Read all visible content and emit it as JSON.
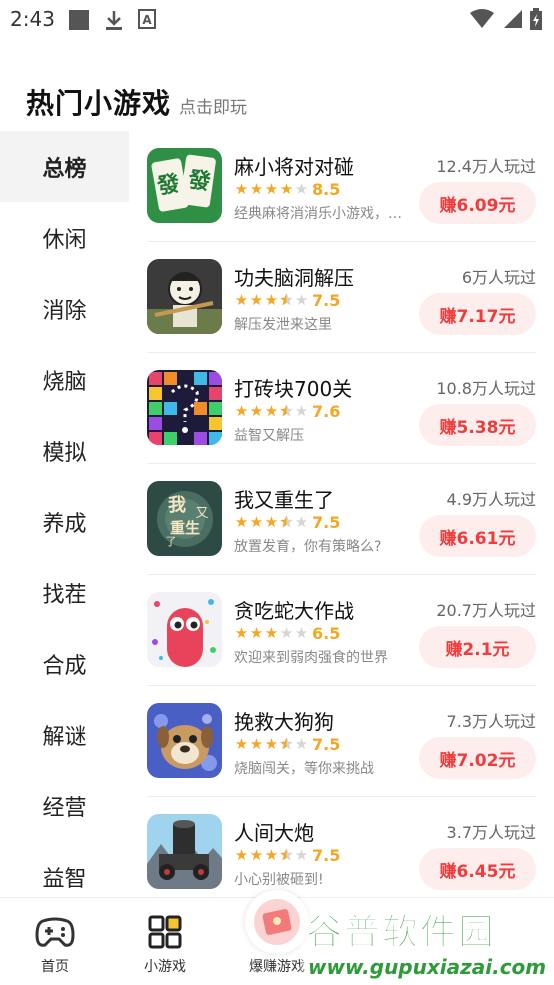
{
  "status_bar": {
    "time": "2:43"
  },
  "header": {
    "title": "热门小游戏",
    "subtitle": "点击即玩"
  },
  "sidebar": {
    "items": [
      {
        "label": "总榜",
        "active": true
      },
      {
        "label": "休闲"
      },
      {
        "label": "消除"
      },
      {
        "label": "烧脑"
      },
      {
        "label": "模拟"
      },
      {
        "label": "养成"
      },
      {
        "label": "找茬"
      },
      {
        "label": "合成"
      },
      {
        "label": "解谜"
      },
      {
        "label": "经营"
      },
      {
        "label": "益智"
      }
    ]
  },
  "games": [
    {
      "name": "麻小将对对碰",
      "players": "12.4万人玩过",
      "rating": "8.5",
      "stars": 4.0,
      "desc": "经典麻将消消乐小游戏，…",
      "earn": "赚6.09元",
      "icon": "mahjong-game-icon"
    },
    {
      "name": "功夫脑洞解压",
      "players": "6万人玩过",
      "rating": "7.5",
      "stars": 3.5,
      "desc": "解压发泄来这里",
      "earn": "赚7.17元",
      "icon": "kungfu-game-icon"
    },
    {
      "name": "打砖块700关",
      "players": "10.8万人玩过",
      "rating": "7.6",
      "stars": 3.5,
      "desc": "益智又解压",
      "earn": "赚5.38元",
      "icon": "brick-breaker-game-icon"
    },
    {
      "name": "我又重生了",
      "players": "4.9万人玩过",
      "rating": "7.5",
      "stars": 3.5,
      "desc": "放置发育，你有策略么?",
      "earn": "赚6.61元",
      "icon": "reborn-game-icon"
    },
    {
      "name": "贪吃蛇大作战",
      "players": "20.7万人玩过",
      "rating": "6.5",
      "stars": 3.0,
      "desc": "欢迎来到弱肉强食的世界",
      "earn": "赚2.1元",
      "icon": "snake-game-icon"
    },
    {
      "name": "挽救大狗狗",
      "players": "7.3万人玩过",
      "rating": "7.5",
      "stars": 3.5,
      "desc": "烧脑闯关，等你来挑战",
      "earn": "赚7.02元",
      "icon": "dog-rescue-game-icon"
    },
    {
      "name": "人间大炮",
      "players": "3.7万人玩过",
      "rating": "7.5",
      "stars": 3.5,
      "desc": "小心别被砸到!",
      "earn": "赚6.45元",
      "icon": "cannon-game-icon"
    }
  ],
  "bottom_nav": {
    "home": "首页",
    "mini_games": "小游戏",
    "earn_games": "爆赚游戏"
  },
  "watermark": {
    "logo": "谷普软件园",
    "url": "www.gupuxiazai.com"
  },
  "colors": {
    "accent_red": "#f03c3c",
    "star": "#f5a623",
    "earn_bg": "#fdeeed",
    "sidebar_active_bg": "#f3f3f3"
  }
}
